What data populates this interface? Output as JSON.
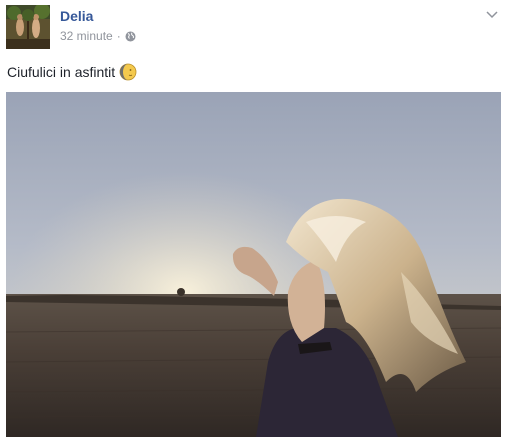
{
  "post": {
    "author": "Delia",
    "time": "32 minute",
    "separator": "·",
    "privacy_icon": "globe-icon",
    "menu_icon": "chevron-down-icon",
    "text": "Ciufulici in asfintit",
    "emoji_icon": "crescent-moon-face-emoji",
    "photo_icon": "photo-sunset-field"
  },
  "colors": {
    "author": "#365899",
    "meta": "#90949c",
    "text": "#1d2129"
  }
}
